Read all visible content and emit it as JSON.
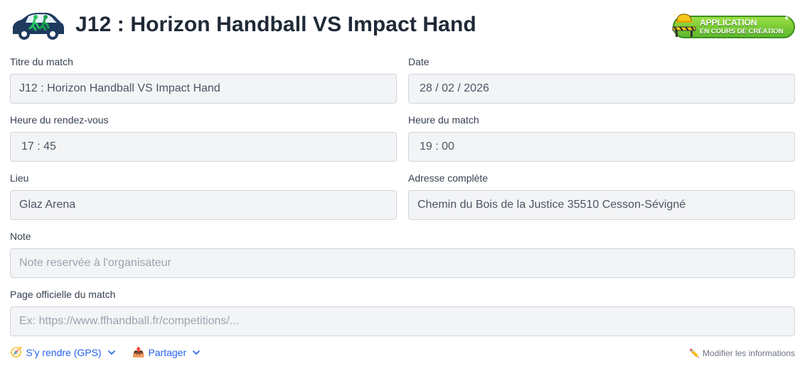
{
  "header": {
    "title": "J12 : Horizon Handball VS Impact Hand",
    "logo_icon": "car-runners-logo-icon",
    "badge": {
      "line1": "APPLICATION",
      "line2": "EN COURS DE CRÉATION",
      "icon": "construction-worker-icon",
      "color": "#7ccf3a"
    }
  },
  "form": {
    "match_title": {
      "label": "Titre du match",
      "value": "J12 : Horizon Handball VS Impact Hand"
    },
    "date": {
      "label": "Date",
      "value": "28 / 02 / 2026"
    },
    "meeting_time": {
      "label": "Heure du rendez-vous",
      "value": "17 : 45"
    },
    "match_time": {
      "label": "Heure du match",
      "value": "19 : 00"
    },
    "place": {
      "label": "Lieu",
      "value": "Glaz Arena"
    },
    "address": {
      "label": "Adresse complète",
      "value": "Chemin du Bois de la Justice 35510 Cesson-Sévigné"
    },
    "note": {
      "label": "Note",
      "value": "",
      "placeholder": "Note reservée à l'organisateur"
    },
    "official_page": {
      "label": "Page officielle du match",
      "value": "",
      "placeholder": "Ex: https://www.ffhandball.fr/competitions/..."
    }
  },
  "actions": {
    "gps": {
      "icon": "🧭",
      "label": "S'y rendre (GPS)"
    },
    "share": {
      "icon": "📤",
      "label": "Partager"
    },
    "edit": {
      "icon": "✏️",
      "label": "Modifier les informations"
    }
  },
  "colors": {
    "accent": "#2563eb",
    "input_bg": "#f3f4f6",
    "input_border": "#d1d5db",
    "title": "#1f2937"
  }
}
